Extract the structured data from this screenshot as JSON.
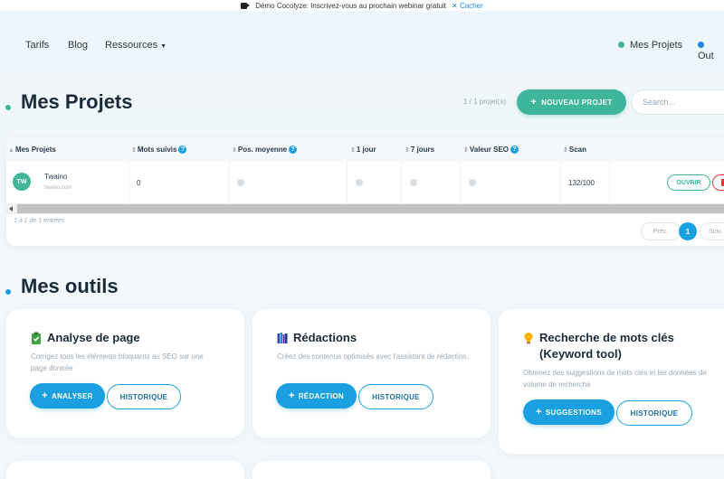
{
  "banner": {
    "text": "Démo Cocolyze: Inscrivez-vous au prochain webinar gratuit",
    "hide_label": "Cacher"
  },
  "nav": {
    "items": [
      {
        "label": "Tarifs"
      },
      {
        "label": "Blog"
      },
      {
        "label": "Ressources"
      }
    ],
    "right_items": [
      {
        "label": "Mes Projets",
        "color": "#3fb59b"
      },
      {
        "label": "Out",
        "color": "#1e88e5"
      }
    ]
  },
  "projects": {
    "title": "Mes Projets",
    "count": "1 / 1 projet(s)",
    "new_button": "NOUVEAU PROJET",
    "search_placeholder": "Search...",
    "columns": [
      "Mes Projets",
      "Mots suivis",
      "Pos. moyenne",
      "1 jour",
      "7 jours",
      "Valeur SEO",
      "Scan"
    ],
    "rows": [
      {
        "initials": "TW",
        "name": "Twaino",
        "url": "twaino.com",
        "keywords": "0",
        "scan": "132/100",
        "open_label": "OUVRIR"
      }
    ],
    "entries": "1 à 1 de 1 entrées",
    "pagination": {
      "prev": "Préc.",
      "current": "1",
      "next": "Suiv."
    }
  },
  "tools": {
    "title": "Mes outils",
    "cards": [
      {
        "icon": "clipboard-check-icon",
        "title": "Analyse de page",
        "desc": "Corrigez tous les éléments bloquants au SEO sur une page donnée",
        "primary": "ANALYSER",
        "secondary": "HISTORIQUE"
      },
      {
        "icon": "books-icon",
        "title": "Rédactions",
        "desc": "Créez des contenus optimisés avec l'assistant de rédaction.",
        "primary": "RÉDACTION",
        "secondary": "HISTORIQUE"
      },
      {
        "icon": "lightbulb-icon",
        "title": "Recherche de mots clés (Keyword tool)",
        "desc": "Obtenez des suggestions de mots clés et les données de volume de recherche",
        "primary": "SUGGESTIONS",
        "secondary": "HISTORIQUE"
      }
    ]
  },
  "colors": {
    "accent_green": "#3fb59b",
    "accent_blue": "#1aa0e0",
    "danger": "#e53935"
  }
}
